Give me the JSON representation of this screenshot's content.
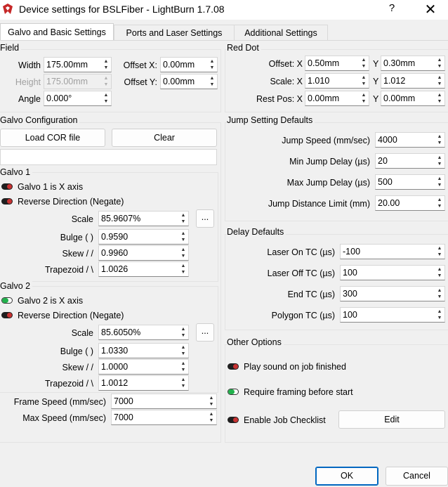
{
  "window": {
    "title": "Device settings for BSLFiber - LightBurn 1.7.08",
    "help": "?",
    "close": "✕"
  },
  "tabs": [
    "Galvo and Basic Settings",
    "Ports and Laser Settings",
    "Additional Settings"
  ],
  "field": {
    "title": "Field",
    "width_label": "Width",
    "width_value": "175.00mm",
    "height_label": "Height",
    "height_value": "175.00mm",
    "angle_label": "Angle",
    "angle_value": "0.000°",
    "offsetx_label": "Offset X:",
    "offsetx_value": "0.00mm",
    "offsety_label": "Offset Y:",
    "offsety_value": "0.00mm"
  },
  "red_dot": {
    "title": "Red Dot",
    "offset_label": "Offset: X",
    "offset_x": "0.50mm",
    "offset_y_label": "Y",
    "offset_y": "0.30mm",
    "scale_label": "Scale: X",
    "scale_x": "1.010",
    "scale_y_label": "Y",
    "scale_y": "1.012",
    "rest_label": "Rest Pos: X",
    "rest_x": "0.00mm",
    "rest_y_label": "Y",
    "rest_y": "0.00mm"
  },
  "galvo_config": {
    "title": "Galvo Configuration",
    "load_button": "Load COR file",
    "clear_button": "Clear",
    "path_value": ""
  },
  "galvo1": {
    "title": "Galvo 1",
    "is_x_label": "Galvo 1 is X axis",
    "is_x_on": false,
    "reverse_label": "Reverse Direction (Negate)",
    "reverse_on": false,
    "scale_label": "Scale",
    "scale_value": "85.9607%",
    "dots": "...",
    "bulge_label": "Bulge (  )",
    "bulge_value": "0.9590",
    "skew_label": "Skew  / /",
    "skew_value": "0.9960",
    "trap_label": "Trapezoid  / \\",
    "trap_value": "1.0026"
  },
  "galvo2": {
    "title": "Galvo 2",
    "is_x_label": "Galvo 2 is X axis",
    "is_x_on": true,
    "reverse_label": "Reverse Direction (Negate)",
    "reverse_on": false,
    "scale_label": "Scale",
    "scale_value": "85.6050%",
    "dots": "...",
    "bulge_label": "Bulge (  )",
    "bulge_value": "1.0330",
    "skew_label": "Skew  / /",
    "skew_value": "1.0000",
    "trap_label": "Trapezoid  / \\",
    "trap_value": "1.0012"
  },
  "speeds": {
    "frame_label": "Frame Speed (mm/sec)",
    "frame_value": "7000",
    "max_label": "Max Speed (mm/sec)",
    "max_value": "7000"
  },
  "jump": {
    "title": "Jump Setting Defaults",
    "speed_label": "Jump Speed (mm/sec)",
    "speed_value": "4000",
    "min_label": "Min Jump Delay (µs)",
    "min_value": "20",
    "max_label": "Max Jump Delay (µs)",
    "max_value": "500",
    "limit_label": "Jump Distance Limit (mm)",
    "limit_value": "20.00"
  },
  "delay": {
    "title": "Delay Defaults",
    "on_label": "Laser On TC (µs)",
    "on_value": "-100",
    "off_label": "Laser Off TC (µs)",
    "off_value": "100",
    "end_label": "End TC (µs)",
    "end_value": "300",
    "poly_label": "Polygon TC (µs)",
    "poly_value": "100"
  },
  "other": {
    "title": "Other Options",
    "sound_label": "Play sound on job finished",
    "sound_on": false,
    "framing_label": "Require framing before start",
    "framing_on": true,
    "checklist_label": "Enable Job Checklist",
    "checklist_on": false,
    "edit_button": "Edit"
  },
  "footer": {
    "ok": "OK",
    "cancel": "Cancel"
  },
  "colors": {
    "toggle_on": "#22b14c",
    "toggle_off": "#c83232",
    "accent": "#0067c0"
  }
}
